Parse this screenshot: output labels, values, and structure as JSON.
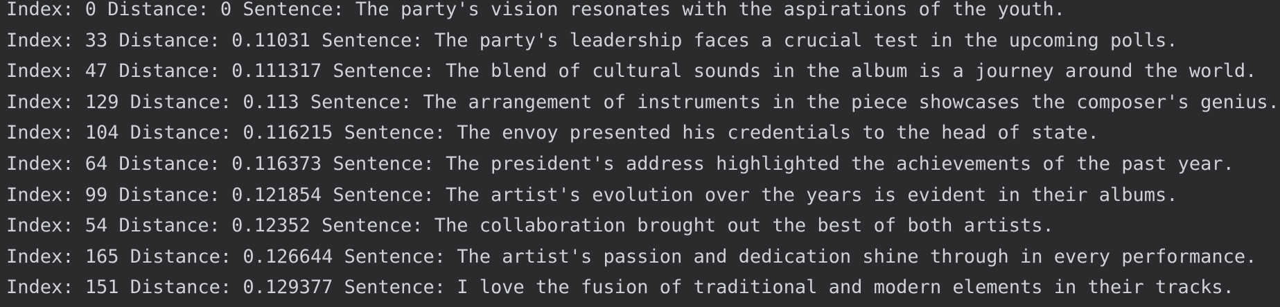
{
  "console": {
    "lines": [
      "Index: 0 Distance: 0 Sentence: The party's vision resonates with the aspirations of the youth.",
      "Index: 33 Distance: 0.11031 Sentence: The party's leadership faces a crucial test in the upcoming polls.",
      "Index: 47 Distance: 0.111317 Sentence: The blend of cultural sounds in the album is a journey around the world.",
      "Index: 129 Distance: 0.113 Sentence: The arrangement of instruments in the piece showcases the composer's genius.",
      "Index: 104 Distance: 0.116215 Sentence: The envoy presented his credentials to the head of state.",
      "Index: 64 Distance: 0.116373 Sentence: The president's address highlighted the achievements of the past year.",
      "Index: 99 Distance: 0.121854 Sentence: The artist's evolution over the years is evident in their albums.",
      "Index: 54 Distance: 0.12352 Sentence: The collaboration brought out the best of both artists.",
      "Index: 165 Distance: 0.126644 Sentence: The artist's passion and dedication shine through in every performance.",
      "Index: 151 Distance: 0.129377 Sentence: I love the fusion of traditional and modern elements in their tracks."
    ]
  },
  "colors": {
    "background": "#2b2b2d",
    "text": "#cfd2d6"
  }
}
